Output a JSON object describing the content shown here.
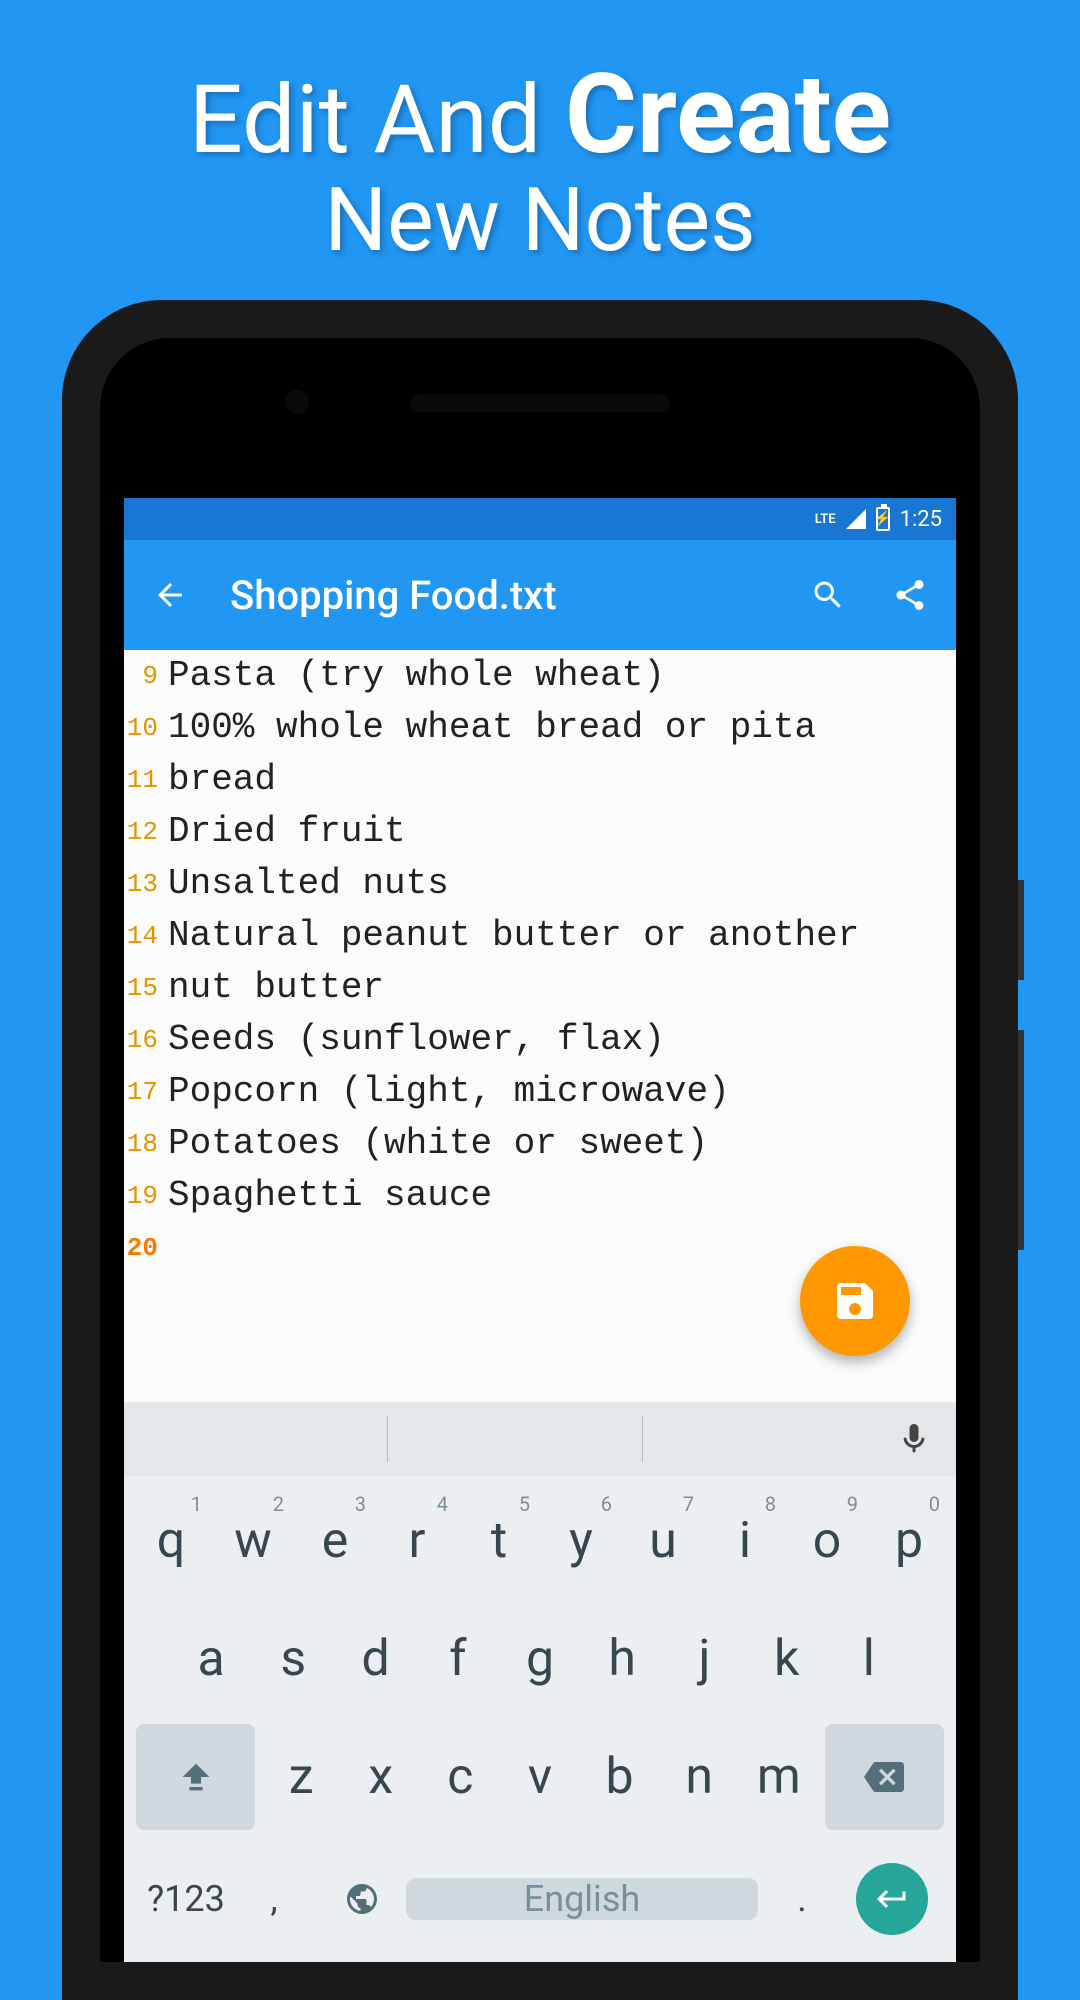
{
  "promo": {
    "line1_a": "Edit And ",
    "line1_b": "Create",
    "line2": "New Notes"
  },
  "status": {
    "lte": "LTE",
    "time": "1:25",
    "batt": "⚡"
  },
  "appbar": {
    "title": "Shopping Food.txt"
  },
  "editor": {
    "lines": [
      {
        "num": "9",
        "text": "Pasta (try whole wheat)"
      },
      {
        "num": "10",
        "text": "100% whole wheat bread or pita"
      },
      {
        "num": "11",
        "text": "bread"
      },
      {
        "num": "12",
        "text": "Dried fruit"
      },
      {
        "num": "13",
        "text": "Unsalted nuts"
      },
      {
        "num": "14",
        "text": "Natural peanut butter or another"
      },
      {
        "num": "15",
        "text": "nut butter"
      },
      {
        "num": "16",
        "text": "Seeds (sunflower, flax)"
      },
      {
        "num": "17",
        "text": "Popcorn (light, microwave)"
      },
      {
        "num": "18",
        "text": "Potatoes (white or sweet)"
      },
      {
        "num": "19",
        "text": "Spaghetti sauce"
      },
      {
        "num": "20",
        "text": ""
      }
    ]
  },
  "keyboard": {
    "row1": [
      {
        "k": "q",
        "n": "1"
      },
      {
        "k": "w",
        "n": "2"
      },
      {
        "k": "e",
        "n": "3"
      },
      {
        "k": "r",
        "n": "4"
      },
      {
        "k": "t",
        "n": "5"
      },
      {
        "k": "y",
        "n": "6"
      },
      {
        "k": "u",
        "n": "7"
      },
      {
        "k": "i",
        "n": "8"
      },
      {
        "k": "o",
        "n": "9"
      },
      {
        "k": "p",
        "n": "0"
      }
    ],
    "row2": [
      "a",
      "s",
      "d",
      "f",
      "g",
      "h",
      "j",
      "k",
      "l"
    ],
    "row3": [
      "z",
      "x",
      "c",
      "v",
      "b",
      "n",
      "m"
    ],
    "symbols": "?123",
    "comma": ",",
    "period": ".",
    "space": "English"
  }
}
